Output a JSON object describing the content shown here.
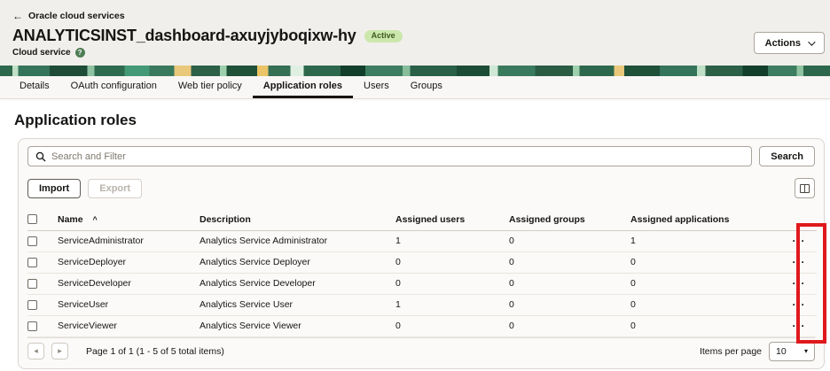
{
  "header": {
    "back_label": "Oracle cloud services",
    "title": "ANALYTICSINST_dashboard-axuyjyboqixw-hy",
    "status_badge": "Active",
    "subtitle": "Cloud service",
    "actions_label": "Actions"
  },
  "tabs": {
    "items": [
      {
        "label": "Details"
      },
      {
        "label": "OAuth configuration"
      },
      {
        "label": "Web tier policy"
      },
      {
        "label": "Application roles"
      },
      {
        "label": "Users"
      },
      {
        "label": "Groups"
      }
    ],
    "active": "Application roles"
  },
  "main": {
    "heading": "Application roles"
  },
  "toolbar": {
    "search_placeholder": "Search and Filter",
    "search_label": "Search",
    "import_label": "Import",
    "export_label": "Export"
  },
  "table": {
    "columns": {
      "name": "Name",
      "description": "Description",
      "users": "Assigned users",
      "groups": "Assigned groups",
      "applications": "Assigned applications"
    },
    "row_menu_icon": "···",
    "rows": [
      {
        "name": "ServiceAdministrator",
        "description": "Analytics Service Administrator",
        "users": "1",
        "groups": "0",
        "applications": "1"
      },
      {
        "name": "ServiceDeployer",
        "description": "Analytics Service Deployer",
        "users": "0",
        "groups": "0",
        "applications": "0"
      },
      {
        "name": "ServiceDeveloper",
        "description": "Analytics Service Developer",
        "users": "0",
        "groups": "0",
        "applications": "0"
      },
      {
        "name": "ServiceUser",
        "description": "Analytics Service User",
        "users": "1",
        "groups": "0",
        "applications": "0"
      },
      {
        "name": "ServiceViewer",
        "description": "Analytics Service Viewer",
        "users": "0",
        "groups": "0",
        "applications": "0"
      }
    ]
  },
  "pagination": {
    "prev_icon": "◂",
    "next_icon": "▸",
    "summary": "Page 1 of 1 (1 - 5 of 5 total items)",
    "items_per_page_label": "Items per page",
    "items_per_page_value": "10"
  },
  "colors": {
    "annotation_red": "#e0191c",
    "badge_green_bg": "#cbe7ac",
    "badge_green_text": "#3f5a1e",
    "help_green": "#4e7d54"
  }
}
